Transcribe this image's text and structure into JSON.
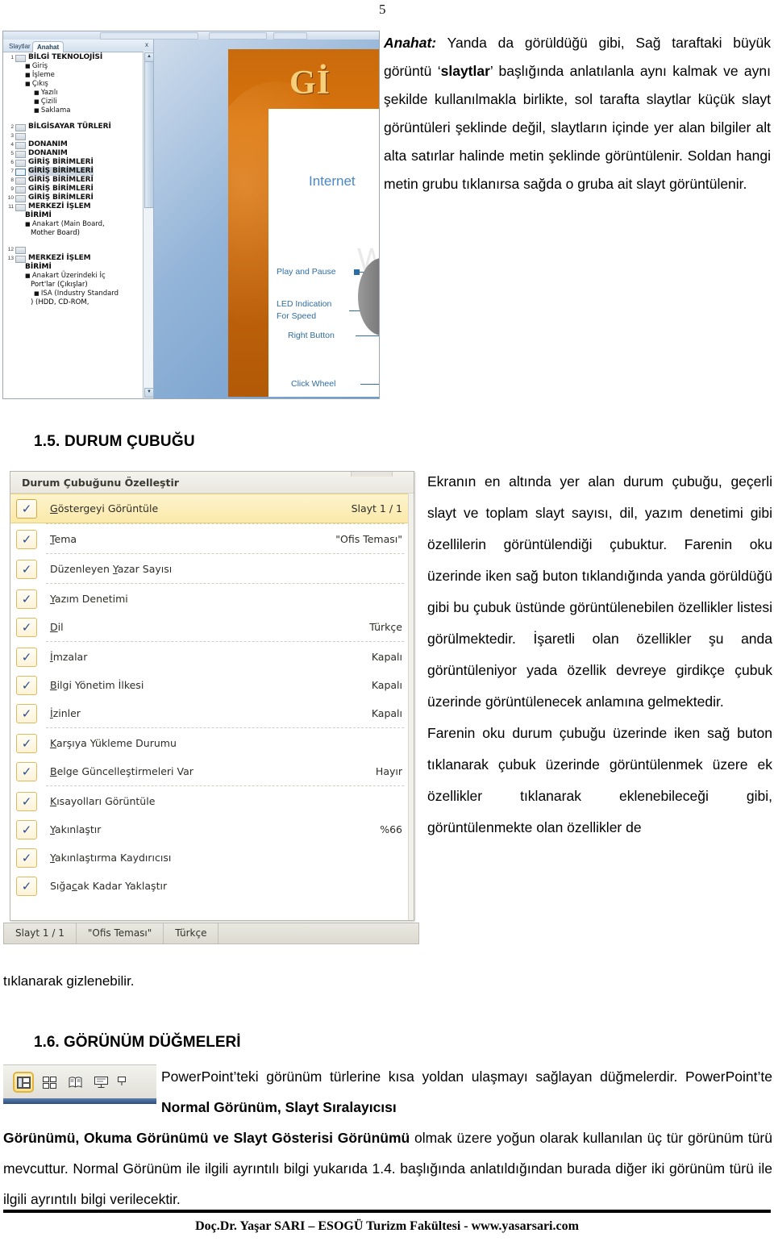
{
  "page": {
    "number": "5"
  },
  "figure_outline": {
    "pane_tabs": {
      "inactive": "Slaytlar",
      "active": "Anahat",
      "close": "x"
    },
    "items": [
      {
        "num": "1",
        "type": "title",
        "text": "BİLGİ TEKNOLOJİSİ"
      },
      {
        "num": "",
        "type": "b1",
        "text": "Giriş"
      },
      {
        "num": "",
        "type": "b1",
        "text": "İşleme"
      },
      {
        "num": "",
        "type": "b1",
        "text": "Çıkış"
      },
      {
        "num": "",
        "type": "b2",
        "text": "Yazılı"
      },
      {
        "num": "",
        "type": "b2",
        "text": "Çizili"
      },
      {
        "num": "",
        "type": "b2",
        "text": "Saklama"
      },
      {
        "num": "2",
        "type": "title",
        "text": "BİLGİSAYAR TÜRLERİ"
      },
      {
        "num": "3",
        "type": "title",
        "text": ""
      },
      {
        "num": "4",
        "type": "title",
        "text": "DONANIM"
      },
      {
        "num": "5",
        "type": "title",
        "text": "DONANIM"
      },
      {
        "num": "6",
        "type": "title",
        "text": "GİRİŞ BİRİMLERİ"
      },
      {
        "num": "7",
        "type": "title",
        "text": "GİRİŞ BİRİMLERİ",
        "current": true
      },
      {
        "num": "8",
        "type": "title",
        "text": "GİRİŞ BİRİMLERİ"
      },
      {
        "num": "9",
        "type": "title",
        "text": "GİRİŞ BİRİMLERİ"
      },
      {
        "num": "10",
        "type": "title",
        "text": "GİRİŞ BİRİMLERİ"
      },
      {
        "num": "11",
        "type": "title",
        "text": "MERKEZİ İŞLEM"
      },
      {
        "num": "",
        "type": "cont",
        "text": "BİRİMİ"
      },
      {
        "num": "",
        "type": "b1",
        "text": "Anakart (Main Board,"
      },
      {
        "num": "",
        "type": "wrap",
        "text": "Mother Board)"
      },
      {
        "num": "12",
        "type": "title",
        "text": ""
      },
      {
        "num": "13",
        "type": "title",
        "text": "MERKEZİ İŞLEM"
      },
      {
        "num": "",
        "type": "cont",
        "text": "BİRİMİ"
      },
      {
        "num": "",
        "type": "b1",
        "text": "Anakart Üzerindeki İç"
      },
      {
        "num": "",
        "type": "wrap",
        "text": "Port'lar (Çıkışlar)"
      },
      {
        "num": "",
        "type": "b2",
        "text": "ISA (Industry Standard"
      },
      {
        "num": "",
        "type": "wrap",
        "text": ") (HDD, CD-ROM,"
      }
    ],
    "slide": {
      "title": "Gİ",
      "watermark": "WWW",
      "internet_label": "Internet",
      "callouts": [
        {
          "label": "Play and Pause"
        },
        {
          "label": "LED Indication"
        },
        {
          "label": "For Speed"
        },
        {
          "label": "Right Button"
        },
        {
          "label": "Click Wheel"
        }
      ]
    }
  },
  "paragraph_anahat": {
    "lead": "Anahat:",
    "before_bold": " Yanda da görüldüğü gibi, Sağ taraftaki büyük görüntü ‘",
    "bold": "slaytlar",
    "after_bold": "’ başlığında anlatılanla aynı kalmak ve aynı şekilde kullanılmakla birlikte, sol tarafta slaytlar küçük slayt görüntüleri şeklinde değil, slaytların içinde yer alan bilgiler alt alta satırlar halinde metin şeklinde görüntülenir. Soldan hangi metin grubu tıklanırsa sağda o gruba ait slayt görüntülenir."
  },
  "heading_15": "1.5. DURUM ÇUBUĞU",
  "status_menu": {
    "title": "Durum Çubuğunu Özelleştir",
    "items": [
      {
        "checked": "✓",
        "label": "Göstergeyi Görüntüle",
        "accel": "G",
        "value": "Slayt 1 / 1",
        "highlight": true,
        "sep_after": true
      },
      {
        "checked": "✓",
        "label": "Tema",
        "accel": "T",
        "value": "\"Ofis Teması\"",
        "sep_after": true
      },
      {
        "checked": "✓",
        "label": "Düzenleyen Yazar Sayısı",
        "accel": "Y",
        "value": "",
        "sep_after": true
      },
      {
        "checked": "✓",
        "label": "Yazım Denetimi",
        "accel": "Y",
        "value": "",
        "sep_after": false
      },
      {
        "checked": "✓",
        "label": "Dil",
        "accel": "D",
        "value": "Türkçe",
        "sep_after": true
      },
      {
        "checked": "✓",
        "label": "İmzalar",
        "accel": "İ",
        "value": "Kapalı",
        "sep_after": false
      },
      {
        "checked": "✓",
        "label": "Bilgi Yönetim İlkesi",
        "accel": "B",
        "value": "Kapalı",
        "sep_after": false
      },
      {
        "checked": "✓",
        "label": "İzinler",
        "accel": "İ",
        "value": "Kapalı",
        "sep_after": true
      },
      {
        "checked": "✓",
        "label": "Karşıya Yükleme Durumu",
        "accel": "K",
        "value": "",
        "sep_after": false
      },
      {
        "checked": "✓",
        "label": "Belge Güncelleştirmeleri Var",
        "accel": "B",
        "value": "Hayır",
        "sep_after": true
      },
      {
        "checked": "✓",
        "label": "Kısayolları Görüntüle",
        "accel": "K",
        "value": "",
        "sep_after": false
      },
      {
        "checked": "✓",
        "label": "Yakınlaştır",
        "accel": "Y",
        "value": "%66",
        "sep_after": false
      },
      {
        "checked": "✓",
        "label": "Yakınlaştırma Kaydırıcısı",
        "accel": "Y",
        "value": "",
        "sep_after": false
      },
      {
        "checked": "✓",
        "label": "Sığacak Kadar Yaklaştır",
        "accel": "c",
        "value": "",
        "sep_after": false
      }
    ],
    "bottom_bar": [
      "Slayt 1 / 1",
      "\"Ofis Teması\"",
      "Türkçe"
    ]
  },
  "paragraph_durum": "Ekranın en altında yer alan durum çubuğu, geçerli slayt ve toplam slayt sayısı, dil, yazım denetimi gibi özellilerin görüntülendiği çubuktur. Farenin oku üzerinde iken sağ buton tıklandığında yanda görüldüğü gibi bu çubuk üstünde görüntülenebilen özellikler listesi görülmektedir. İşaretli olan özellikler şu anda görüntüleniyor yada özellik devreye girdikçe çubuk üzerinde görüntülenecek anlamına gelmektedir.",
  "paragraph_durum2_start": "Farenin oku durum çubuğu üzerinde iken sağ buton tıklanarak çubuk üzerinde görüntülenmek üzere ek özellikler tıklanarak eklenebileceği gibi, görüntülenmekte olan özellikler de",
  "paragraph_durum2_end": "tıklanarak gizlenebilir.",
  "heading_16": "1.6. GÖRÜNÜM DÜĞMELERİ",
  "view_buttons": {
    "icons": [
      "normal-view-icon",
      "slide-sorter-icon",
      "reading-view-icon",
      "slide-show-icon",
      "partial-icon"
    ],
    "selected_index": 0
  },
  "paragraph_16a_pre": "PowerPoint’teki görünüm türlerine kısa yoldan ulaşmayı sağlayan düğmelerdir. PowerPoint’te ",
  "paragraph_16a_bold": "Normal Görünüm, Slayt Sıralayıcısı",
  "paragraph_16b_bold": "Görünümü, Okuma Görünümü ve Slayt Gösterisi Görünümü",
  "paragraph_16b_rest": " olmak üzere yoğun olarak kullanılan üç tür görünüm türü mevcuttur. Normal Görünüm ile ilgili ayrıntılı bilgi yukarıda 1.4. başlığında anlatıldığından burada diğer iki görünüm türü ile ilgili ayrıntılı bilgi verilecektir.",
  "footer": "Doç.Dr. Yaşar SARI – ESOGÜ Turizm Fakültesi - www.yasarsari.com"
}
